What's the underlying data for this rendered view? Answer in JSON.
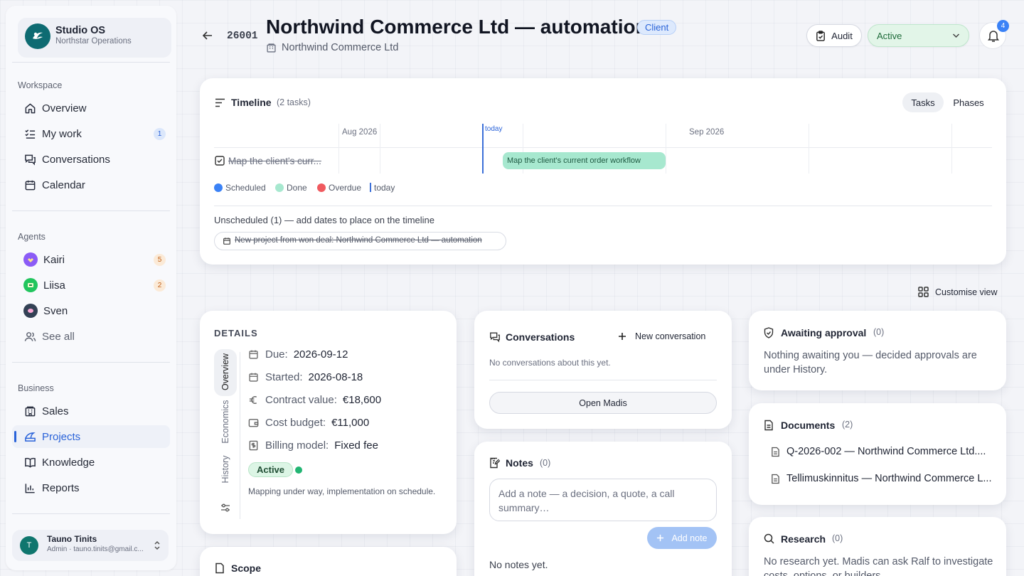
{
  "brand": {
    "title": "Studio OS",
    "subtitle": "Northstar Operations"
  },
  "sidebar": {
    "workspace_label": "Workspace",
    "workspace": [
      {
        "label": "Overview",
        "icon": "home-icon"
      },
      {
        "label": "My work",
        "icon": "list-check-icon",
        "badge": "1"
      },
      {
        "label": "Conversations",
        "icon": "chat-icon"
      },
      {
        "label": "Calendar",
        "icon": "calendar-icon"
      }
    ],
    "agents_label": "Agents",
    "agents": [
      {
        "label": "Kairi",
        "badge": "5",
        "color": "#8b5cf6"
      },
      {
        "label": "Liisa",
        "badge": "2",
        "color": "#22c55e"
      },
      {
        "label": "Sven",
        "color": "#334155"
      }
    ],
    "see_all": "See all",
    "business_label": "Business",
    "business": [
      {
        "label": "Sales",
        "icon": "building-icon"
      },
      {
        "label": "Projects",
        "icon": "projects-icon",
        "active": true
      },
      {
        "label": "Knowledge",
        "icon": "book-icon"
      },
      {
        "label": "Reports",
        "icon": "chart-icon"
      }
    ],
    "user": {
      "initial": "T",
      "name": "Tauno Tinits",
      "meta": "Admin · tauno.tinits@gmail.c..."
    }
  },
  "header": {
    "id": "26001",
    "title": "Northwind Commerce Ltd — automation",
    "tag": "Client",
    "company": "Northwind Commerce Ltd",
    "audit_label": "Audit",
    "status_value": "Active",
    "notifications": "4"
  },
  "timeline": {
    "title": "Timeline",
    "count": "(2 tasks)",
    "tabs": [
      "Tasks",
      "Phases"
    ],
    "months": [
      "Aug 2026",
      "Sep 2026"
    ],
    "today_label": "today",
    "task_name": "Map the client's curr...",
    "bar_label": "Map the client's current order workflow",
    "legend": [
      "Scheduled",
      "Done",
      "Overdue",
      "today"
    ],
    "legend_colors": [
      "#3b82f6",
      "#a7e8cf",
      "#f05a5f"
    ],
    "unscheduled_text": "Unscheduled (1) — add dates to place on the timeline",
    "unscheduled_item": "New project from won deal: Northwind Commerce Ltd — automation"
  },
  "customise_label": "Customise view",
  "details": {
    "title": "DETAILS",
    "tabs": [
      "Overview",
      "Economics",
      "History"
    ],
    "due_label": "Due:",
    "due": "2026-09-12",
    "started_label": "Started:",
    "started": "2026-08-18",
    "contract_label": "Contract value:",
    "contract": "€18,600",
    "budget_label": "Cost budget:",
    "budget": "€11,000",
    "billing_label": "Billing model:",
    "billing": "Fixed fee",
    "status": "Active",
    "note": "Mapping under way, implementation on schedule."
  },
  "scope": {
    "title": "Scope"
  },
  "conversations": {
    "title": "Conversations",
    "new_label": "New conversation",
    "empty": "No conversations about this yet.",
    "open_label": "Open Madis"
  },
  "notes": {
    "title": "Notes",
    "count": "(0)",
    "placeholder": "Add a note — a decision, a quote, a call summary…",
    "add_label": "Add note",
    "empty": "No notes yet."
  },
  "approval": {
    "title": "Awaiting approval",
    "count": "(0)",
    "text": "Nothing awaiting you — decided approvals are under History."
  },
  "documents": {
    "title": "Documents",
    "count": "(2)",
    "items": [
      "Q-2026-002 — Northwind Commerce Ltd....",
      "Tellimuskinnitus — Northwind Commerce L..."
    ]
  },
  "research": {
    "title": "Research",
    "count": "(0)",
    "text": "No research yet. Madis can ask Ralf to investigate costs, options, or builders."
  }
}
